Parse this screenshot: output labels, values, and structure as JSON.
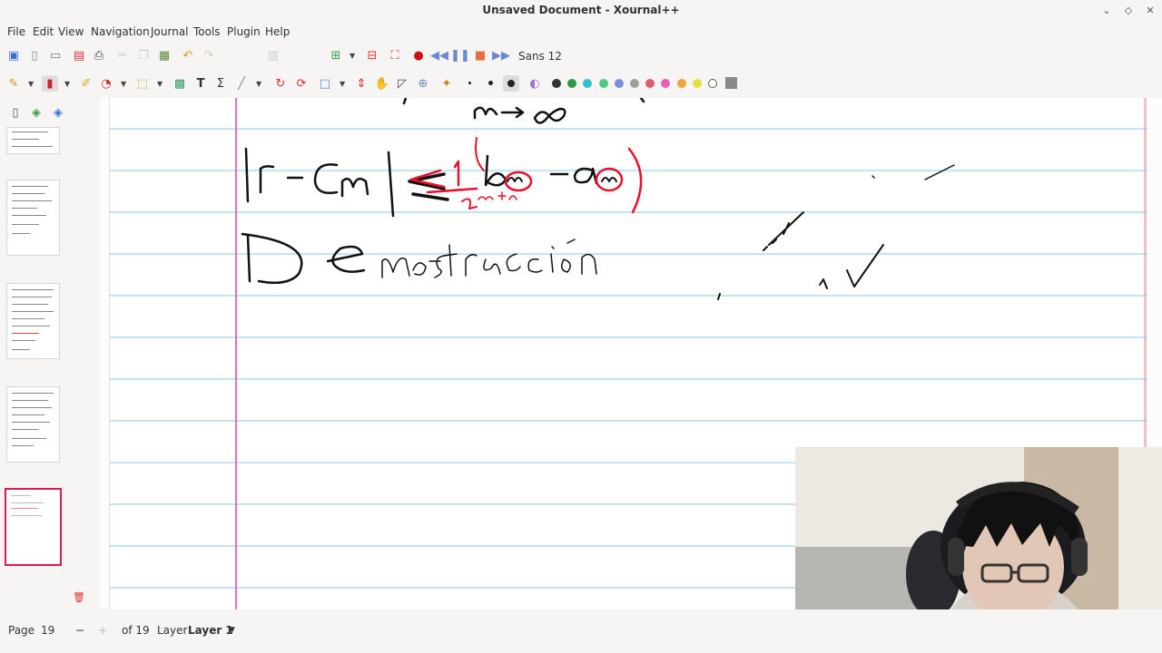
{
  "window": {
    "title": "Unsaved Document - Xournal++",
    "controls": [
      "⌄",
      "◇",
      "✕"
    ]
  },
  "menu": [
    "File",
    "Edit",
    "View",
    "Navigation",
    "Journal",
    "Tools",
    "Plugin",
    "Help"
  ],
  "toolbar1": {
    "font_label": "Sans 12"
  },
  "toolbar2": {
    "colors": [
      "#333333",
      "#2e9a44",
      "#36c0d4",
      "#4ec980",
      "#7a8fdc",
      "#a0a0a0",
      "#e05c6c",
      "#e95cb8",
      "#f2a33a",
      "#e7e03c",
      "#ffffff"
    ],
    "active_color": "#8a8a8a"
  },
  "status": {
    "page_label": "Page",
    "page_value": "19",
    "of_label": "of 19",
    "layer_label": "Layer",
    "layer_value": "Layer 1"
  },
  "sidebar": {
    "page_count_visible": 5,
    "active_index": 4
  },
  "note": {
    "line1": "m→∞",
    "line2_black": "|r − Cm| ≤",
    "line2_red": "1/2^{m+n} (bm − am)",
    "line3": "Demostración"
  },
  "colors": {
    "margin_line": "#e040a0",
    "rule_line": "#8ac8e8",
    "ink_black": "#111111",
    "ink_red": "#e8102a",
    "thumb_active": "#e0194f"
  }
}
